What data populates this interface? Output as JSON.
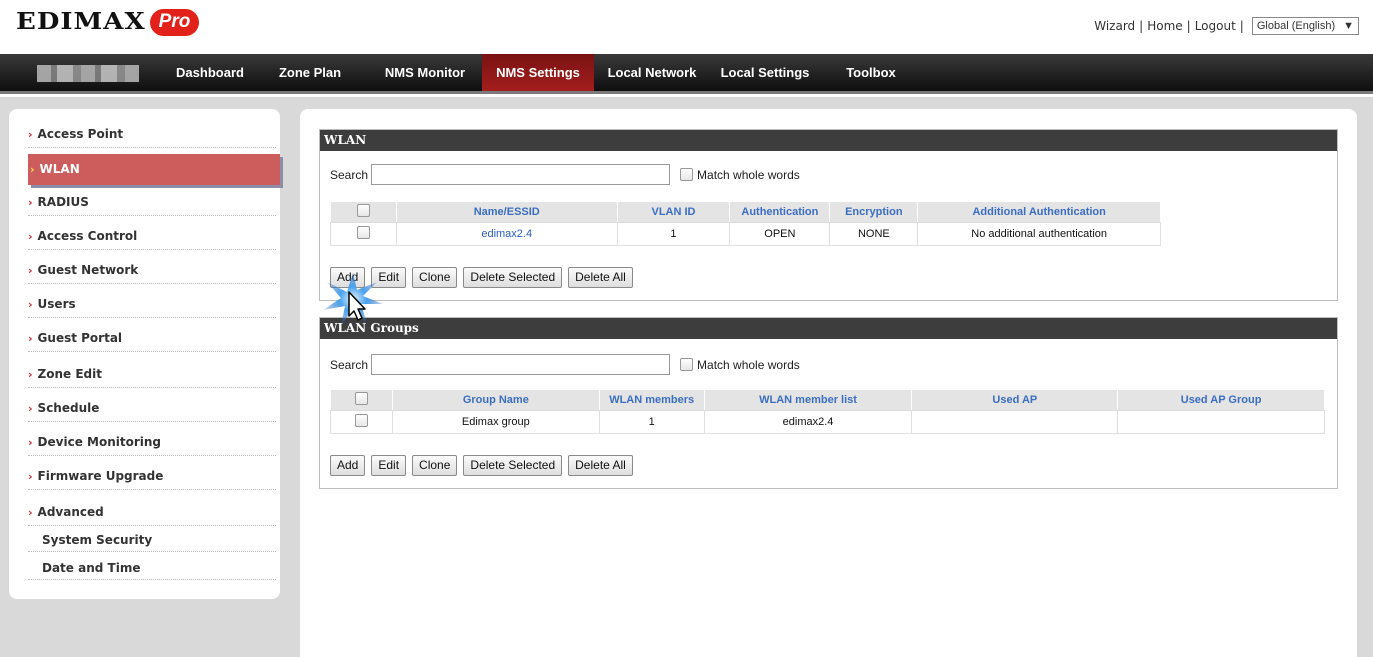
{
  "brand": {
    "logo_text": "EDIMAX",
    "logo_pill": "Pro"
  },
  "top_links": {
    "wizard": "Wizard",
    "home": "Home",
    "logout": "Logout",
    "language": "Global (English)",
    "sep1": "|",
    "sep2": "|",
    "sep3": "|"
  },
  "nav": {
    "items": [
      "Dashboard",
      "Zone Plan",
      "NMS Monitor",
      "NMS Settings",
      "Local Network",
      "Local Settings",
      "Toolbox"
    ],
    "active": "NMS Settings"
  },
  "sidebar": {
    "items": [
      "Access Point",
      "WLAN",
      "RADIUS",
      "Access Control",
      "Guest Network",
      "Users",
      "Guest Portal",
      "Zone Edit",
      "Schedule",
      "Device Monitoring",
      "Firmware Upgrade",
      "Advanced"
    ],
    "sub_items": [
      "System Security",
      "Date and Time"
    ],
    "active": "WLAN",
    "chevron": "›"
  },
  "wlan": {
    "title": "WLAN",
    "search_label": "Search",
    "match_label": "Match whole words",
    "columns": [
      "Name/ESSID",
      "VLAN ID",
      "Authentication",
      "Encryption",
      "Additional Authentication"
    ],
    "rows": [
      {
        "name": "edimax2.4",
        "vlan": "1",
        "auth": "OPEN",
        "enc": "NONE",
        "additional": "No additional authentication"
      }
    ],
    "buttons": [
      "Add",
      "Edit",
      "Clone",
      "Delete Selected",
      "Delete All"
    ]
  },
  "wlan_groups": {
    "title": "WLAN Groups",
    "search_label": "Search",
    "match_label": "Match whole words",
    "columns": [
      "Group Name",
      "WLAN members",
      "WLAN member list",
      "Used AP",
      "Used AP Group"
    ],
    "rows": [
      {
        "group": "Edimax group",
        "members": "1",
        "list": "edimax2.4",
        "used_ap": "",
        "used_ap_group": ""
      }
    ],
    "buttons": [
      "Add",
      "Edit",
      "Clone",
      "Delete Selected",
      "Delete All"
    ]
  },
  "colors": {
    "accent": "#cd5c5c",
    "nav_active": "#a41e1e",
    "header_dark": "#3d3d3d",
    "link": "#3b6ec2"
  }
}
